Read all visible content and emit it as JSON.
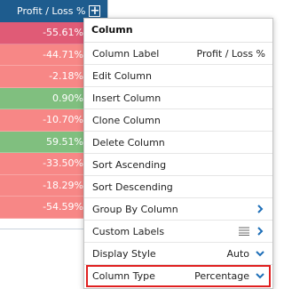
{
  "column": {
    "header_label": "Profit / Loss %",
    "cells": [
      {
        "value": "-55.61%",
        "tone": "neg-strong"
      },
      {
        "value": "-44.71%",
        "tone": "neg"
      },
      {
        "value": "-2.18%",
        "tone": "neg"
      },
      {
        "value": "0.90%",
        "tone": "pos"
      },
      {
        "value": "-10.70%",
        "tone": "neg"
      },
      {
        "value": "59.51%",
        "tone": "pos"
      },
      {
        "value": "-33.50%",
        "tone": "neg"
      },
      {
        "value": "-18.29%",
        "tone": "neg"
      },
      {
        "value": "-54.59%",
        "tone": "neg"
      }
    ]
  },
  "menu": {
    "title": "Column",
    "items": [
      {
        "label": "Column Label",
        "value": "Profit / Loss %"
      },
      {
        "label": "Edit Column"
      },
      {
        "label": "Insert Column"
      },
      {
        "label": "Clone Column"
      },
      {
        "label": "Delete Column"
      },
      {
        "label": "Sort Ascending"
      },
      {
        "label": "Sort Descending"
      },
      {
        "label": "Group By Column"
      },
      {
        "label": "Custom Labels"
      },
      {
        "label": "Display Style",
        "value": "Auto"
      },
      {
        "label": "Column Type",
        "value": "Percentage"
      }
    ]
  },
  "colors": {
    "header_bg": "#1e5c8e",
    "negative_strong": "#e05b76",
    "negative": "#f78786",
    "positive": "#80bf7f",
    "chevron": "#1e6fb8",
    "highlight_border": "#e02020"
  }
}
